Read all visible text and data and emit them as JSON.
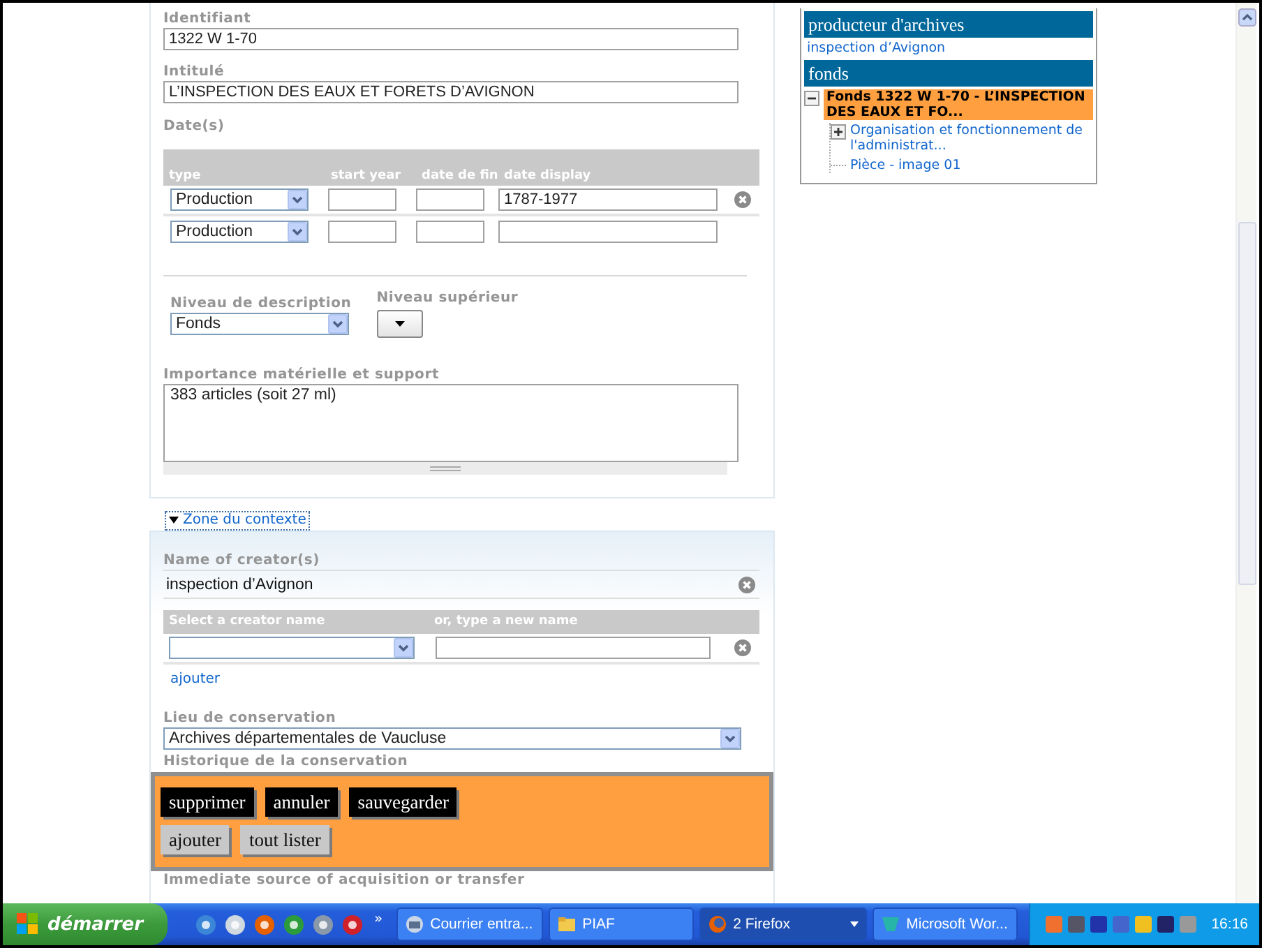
{
  "form": {
    "identifiant": {
      "label": "Identifiant",
      "value": "1322 W 1-70"
    },
    "intitule": {
      "label": "Intitulé",
      "value": "L’INSPECTION DES EAUX ET FORETS D’AVIGNON"
    },
    "dates": {
      "label": "Date(s)",
      "columns": [
        "type",
        "start year",
        "date de fin",
        "date display"
      ],
      "rows": [
        {
          "type": "Production",
          "date_display": "1787-1977",
          "removable": true
        },
        {
          "type": "Production"
        }
      ]
    },
    "niveau_description": {
      "label": "Niveau de description",
      "value": "Fonds"
    },
    "niveau_superieur": {
      "label": "Niveau supérieur"
    },
    "importance": {
      "label": "Importance matérielle et support",
      "value": "383 articles (soit 27 ml)"
    }
  },
  "context_toggle": {
    "label": "Zone du contexte",
    "expanded": true
  },
  "context": {
    "creators": {
      "label": "Name of creator(s)",
      "items": [
        {
          "name": "inspection d’Avignon",
          "removable": true
        }
      ]
    },
    "creator_picker": {
      "columns": [
        "Select a creator name",
        "or, type a new name"
      ],
      "add_link": "ajouter"
    },
    "lieu": {
      "label": "Lieu de conservation",
      "value": "Archives départementales de Vaucluse"
    },
    "historique_label": "Historique de la conservation",
    "acquisition_label": "Immediate source of acquisition or transfer"
  },
  "action_rows": [
    [
      {
        "label": "supprimer",
        "kind": "dark"
      },
      {
        "label": "annuler",
        "kind": "dark"
      },
      {
        "label": "sauvegarder",
        "kind": "dark"
      }
    ],
    [
      {
        "label": "ajouter",
        "kind": "light"
      },
      {
        "label": "tout lister",
        "kind": "light"
      }
    ]
  ],
  "tree_panel": {
    "producer_header": "producteur d'archives",
    "producer_link": "inspection d’Avignon",
    "fonds_header": "fonds",
    "tree": [
      {
        "label": "Fonds 1322 W 1-70 - L’INSPECTION DES EAUX ET FO...",
        "expanded": true,
        "selected": true,
        "children": [
          {
            "label": "Organisation et fonctionnement de l'administrat...",
            "expandable": true,
            "selected": false
          },
          {
            "label": "Pièce - image 01",
            "selected": false
          }
        ]
      }
    ]
  },
  "taskbar": {
    "start": "démarrer",
    "more": "»",
    "tasks": [
      {
        "label": "Courrier entra...",
        "kind": "mail",
        "selected": false
      },
      {
        "label": "PIAF",
        "kind": "folder",
        "selected": false
      },
      {
        "label": "2 Firefox",
        "kind": "browser",
        "selected": true,
        "grouped": true
      },
      {
        "label": "Microsoft Wor...",
        "kind": "word",
        "selected": false
      }
    ],
    "clock": "16:16"
  }
}
